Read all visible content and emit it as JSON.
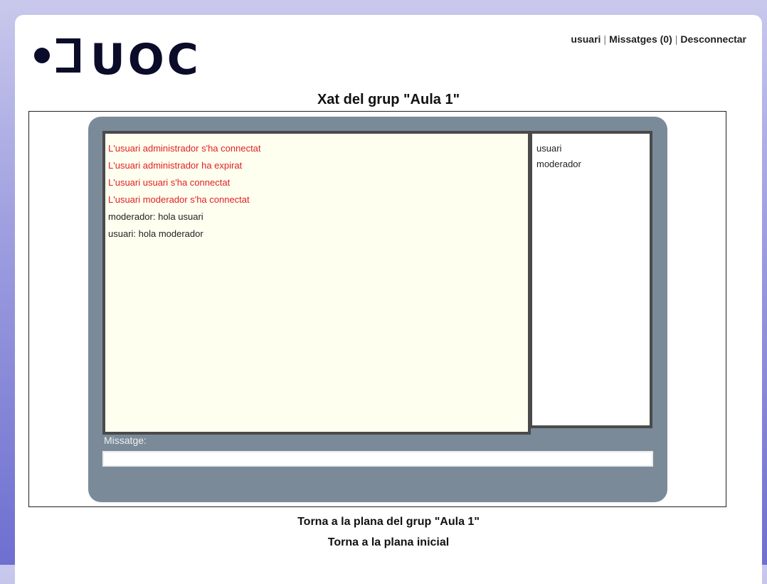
{
  "header": {
    "logo_text": "UOC",
    "nav": {
      "user": "usuari",
      "separator": "|",
      "messages": "Missatges (0)",
      "logout": "Desconnectar"
    }
  },
  "chat": {
    "title": "Xat del grup \"Aula 1\"",
    "messages": [
      {
        "text": "L'usuari administrador s'ha connectat",
        "type": "system"
      },
      {
        "text": "L'usuari administrador ha expirat",
        "type": "system"
      },
      {
        "text": "L'usuari usuari s'ha connectat",
        "type": "system"
      },
      {
        "text": "L'usuari moderador s'ha connectat",
        "type": "system"
      },
      {
        "text": "moderador: hola usuari",
        "type": "user"
      },
      {
        "text": "usuari: hola moderador",
        "type": "user"
      }
    ],
    "users": [
      "usuari",
      "moderador"
    ],
    "input_label": "Missatge:",
    "input_value": ""
  },
  "footer": {
    "back_group": "Torna a la plana del grup \"Aula 1\"",
    "back_home": "Torna a la plana inicial"
  },
  "colors": {
    "background_gradient_top": "#c9c8ec",
    "background_gradient_bottom": "#6e6fd0",
    "panel": "#7a8a99",
    "messages_bg": "#fffff0",
    "system_message": "#e02020"
  }
}
